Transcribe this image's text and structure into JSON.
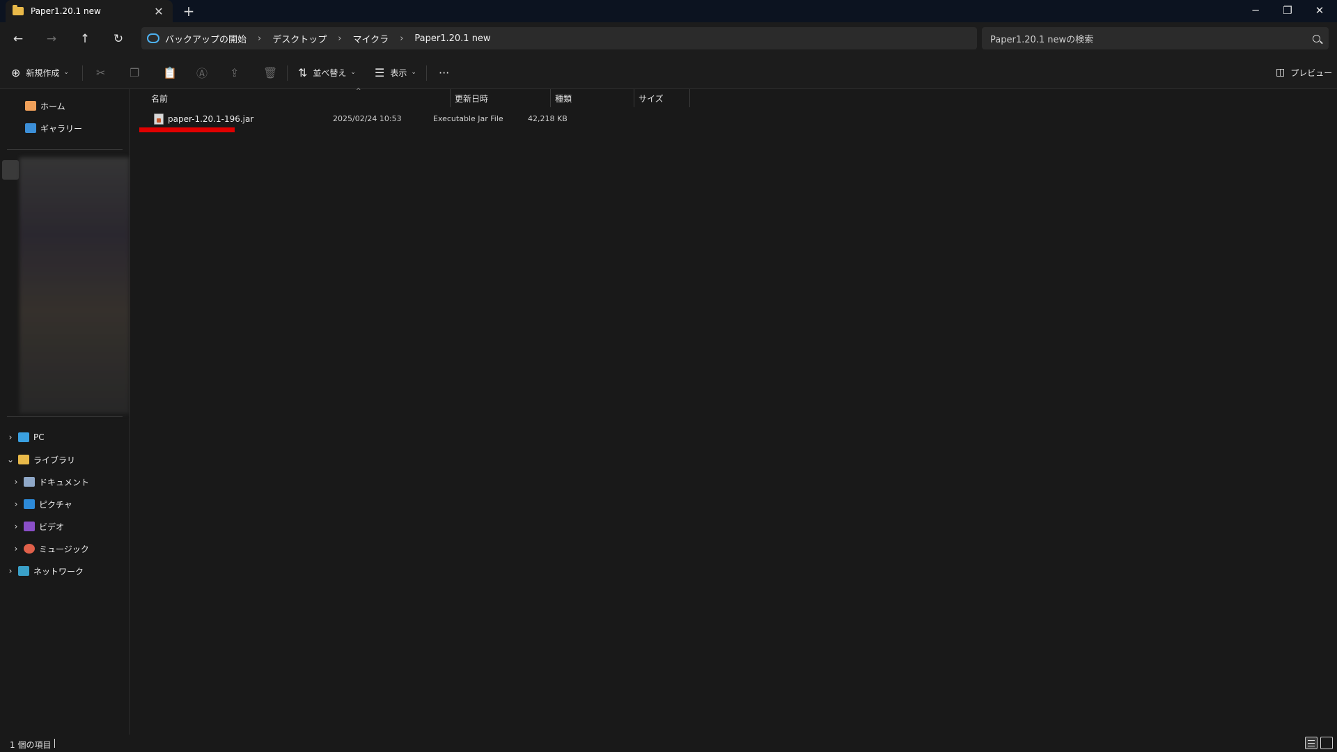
{
  "tab": {
    "title": "Paper1.20.1 new",
    "close": "✕",
    "new": "+"
  },
  "window": {
    "minimize": "─",
    "restore": "❐",
    "close": "✕"
  },
  "nav": {
    "back": "←",
    "forward": "→",
    "up": "↑",
    "refresh": "↻"
  },
  "breadcrumbs": [
    "バックアップの開始",
    "デスクトップ",
    "マイクラ",
    "Paper1.20.1 new"
  ],
  "breadcrumb_separator": "›",
  "search": {
    "placeholder": "Paper1.20.1 newの検索"
  },
  "commands": {
    "new_label": "新規作成",
    "sort_label": "並べ替え",
    "view_label": "表示",
    "more": "···",
    "preview_label": "プレビュー"
  },
  "sidebar": {
    "quick": [
      {
        "label": "ホーム",
        "icon": "home-icon"
      },
      {
        "label": "ギャラリー",
        "icon": "gallery-icon"
      }
    ],
    "tree": [
      {
        "label": "PC",
        "icon": "pc-icon",
        "expanded": false
      },
      {
        "label": "ライブラリ",
        "icon": "folder-icon",
        "expanded": true
      },
      {
        "label": "ドキュメント",
        "icon": "documents-icon",
        "expanded": false
      },
      {
        "label": "ピクチャ",
        "icon": "pictures-icon",
        "expanded": false
      },
      {
        "label": "ビデオ",
        "icon": "videos-icon",
        "expanded": false
      },
      {
        "label": "ミュージック",
        "icon": "music-icon",
        "expanded": false
      },
      {
        "label": "ネットワーク",
        "icon": "network-icon",
        "expanded": false
      }
    ]
  },
  "columns": [
    "名前",
    "更新日時",
    "種類",
    "サイズ"
  ],
  "files": [
    {
      "name": "paper-1.20.1-196.jar",
      "modified": "2025/02/24 10:53",
      "type": "Executable Jar File",
      "size": "42,218 KB"
    }
  ],
  "status": {
    "count": "1 個の項目"
  },
  "colors": {
    "background": "#191919",
    "titlebar": "#0c1320",
    "highlight": "#e00000",
    "folder": "#e9b949"
  }
}
